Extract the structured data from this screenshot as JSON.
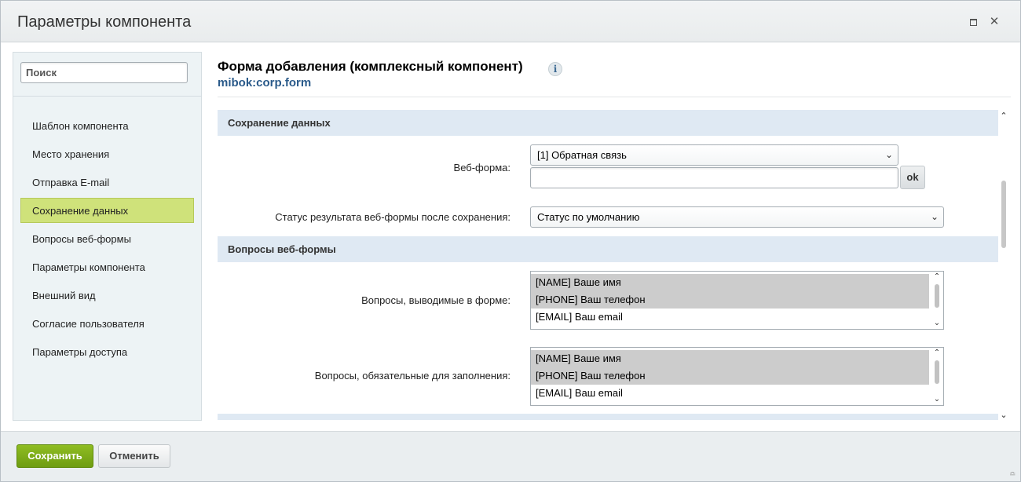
{
  "window": {
    "title": "Параметры компонента",
    "maximize_icon": "maximize-icon",
    "close_icon": "close-icon",
    "close_glyph": "✕"
  },
  "sidebar": {
    "search_placeholder": "Поиск",
    "items": [
      {
        "label": "Шаблон компонента",
        "active": false
      },
      {
        "label": "Место хранения",
        "active": false
      },
      {
        "label": "Отправка E-mail",
        "active": false
      },
      {
        "label": "Сохранение данных",
        "active": true
      },
      {
        "label": "Вопросы веб-формы",
        "active": false
      },
      {
        "label": "Параметры компонента",
        "active": false
      },
      {
        "label": "Внешний вид",
        "active": false
      },
      {
        "label": "Согласие пользователя",
        "active": false
      },
      {
        "label": "Параметры доступа",
        "active": false
      }
    ]
  },
  "header": {
    "component_title": "Форма добавления (комплексный компонент)",
    "component_code": "mibok:corp.form",
    "info_glyph": "i"
  },
  "sections": {
    "save_data": {
      "title": "Сохранение данных",
      "webform_label": "Веб-форма:",
      "webform_value": "[1] Обратная связь",
      "webform_input_value": "",
      "ok_label": "ok",
      "status_label": "Статус результата веб-формы после сохранения:",
      "status_value": "Статус по умолчанию"
    },
    "questions": {
      "title": "Вопросы веб-формы",
      "shown_label": "Вопросы, выводимые в форме:",
      "shown_items": [
        {
          "label": "[NAME] Ваше имя",
          "selected": true
        },
        {
          "label": "[PHONE] Ваш телефон",
          "selected": true
        },
        {
          "label": "[EMAIL] Ваш email",
          "selected": false
        }
      ],
      "required_label": "Вопросы, обязательные для заполнения:",
      "required_items": [
        {
          "label": "[NAME] Ваше имя",
          "selected": true
        },
        {
          "label": "[PHONE] Ваш телефон",
          "selected": true
        },
        {
          "label": "[EMAIL] Ваш email",
          "selected": false
        }
      ]
    }
  },
  "footer": {
    "save_label": "Сохранить",
    "cancel_label": "Отменить"
  },
  "colors": {
    "active_nav": "#cfe27a",
    "section_bg": "#dfe9f3",
    "save_button": "#7dac17",
    "code_link": "#2a5a8a"
  }
}
